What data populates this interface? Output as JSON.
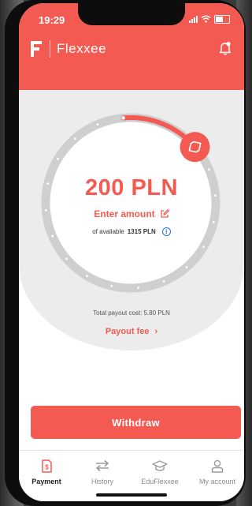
{
  "status_bar": {
    "time": "19:29"
  },
  "header": {
    "app_name": "Flexxee",
    "logo_letter": "F"
  },
  "dial": {
    "selected_fraction": 0.15
  },
  "amount": {
    "value": "200 PLN",
    "enter_label": "Enter amount",
    "available_prefix": "of available",
    "available_value": "1315 PLN"
  },
  "payout": {
    "total_cost": "Total payout cost: 5.80 PLN",
    "fee_link": "Payout fee",
    "fee_chevron": "›"
  },
  "withdraw_label": "Withdraw",
  "tabs": [
    {
      "label": "Payment",
      "icon": "payment-icon"
    },
    {
      "label": "History",
      "icon": "transfer-arrows-icon"
    },
    {
      "label": "EduFlexxee",
      "icon": "graduation-cap-icon"
    },
    {
      "label": "My account",
      "icon": "user-icon"
    }
  ],
  "colors": {
    "accent": "#f35a52",
    "track": "#cfcfcf",
    "background": "#ececec",
    "info": "#2f6fdc"
  }
}
